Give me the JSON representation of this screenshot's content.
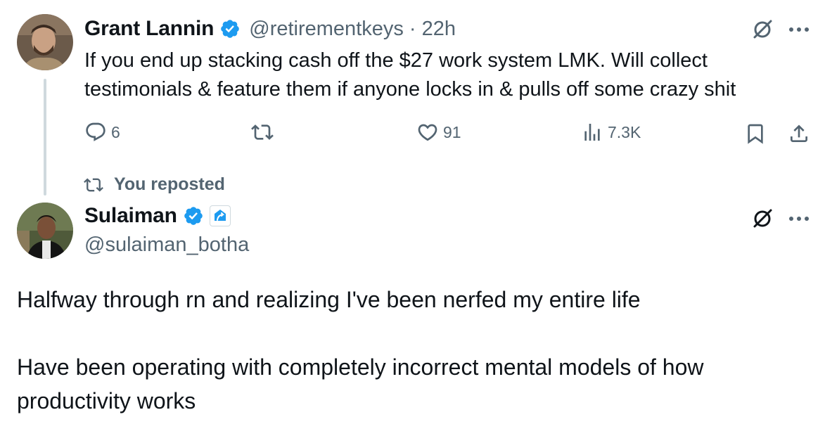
{
  "tweet1": {
    "name": "Grant Lannin",
    "handle": "@retirementkeys",
    "separator": "·",
    "time": "22h",
    "line1": "If you end up stacking cash off the $27 work system LMK. Will collect",
    "line2": "testimonials & feature them if anyone locks in & pulls off some crazy shit",
    "replies": "6",
    "likes": "91",
    "views": "7.3K"
  },
  "repost_banner": "You reposted",
  "tweet2": {
    "name": "Sulaiman",
    "handle": "@sulaiman_botha",
    "paragraph1": "Halfway through rn and realizing I've been nerfed my entire life",
    "paragraph2_line1": "Have been operating with completely incorrect mental models of how",
    "paragraph2_line2": "productivity works"
  },
  "colors": {
    "verified": "#1d9bf0",
    "text": "#0f1419",
    "muted": "#536471",
    "thread_line": "#cfd9de"
  },
  "icons": [
    "verified-badge-icon",
    "grok-icon",
    "more-icon",
    "reply-icon",
    "retweet-icon",
    "like-icon",
    "views-icon",
    "bookmark-icon",
    "share-icon",
    "affiliate-badge-icon"
  ]
}
